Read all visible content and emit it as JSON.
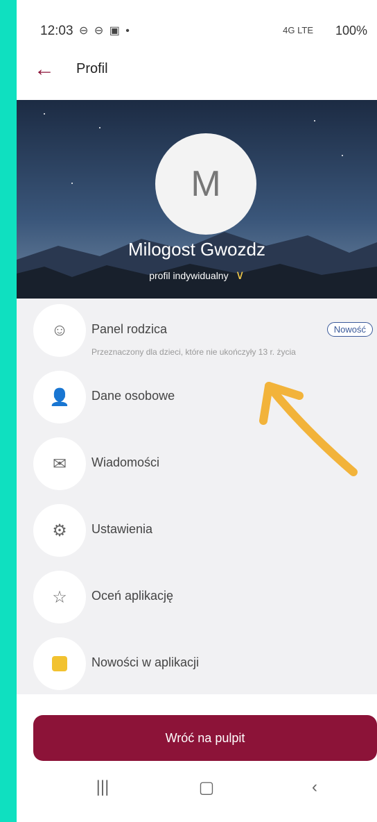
{
  "status_bar": {
    "time": "12:03",
    "left_icons": "⊖ ⊖ ▣ •",
    "network": "4G LTE",
    "battery": "100%"
  },
  "app_bar": {
    "title": "Profil",
    "back_icon": "arrow-left-icon"
  },
  "profile": {
    "avatar_letter": "M",
    "name": "Milogost Gwozdz",
    "type": "profil indywidualny"
  },
  "menu": [
    {
      "label": "Panel rodzica",
      "sub": "Przeznaczony dla dzieci, które nie ukończyły 13 r. życia",
      "badge": "Nowość",
      "icon": "child-face-icon"
    },
    {
      "label": "Dane osobowe",
      "icon": "person-icon"
    },
    {
      "label": "Wiadomości",
      "icon": "envelope-icon"
    },
    {
      "label": "Ustawienia",
      "icon": "gear-icon"
    },
    {
      "label": "Oceń aplikację",
      "icon": "star-icon"
    },
    {
      "label": "Nowości w aplikacji",
      "icon": "news-icon"
    }
  ],
  "actions": {
    "return_button": "Wróć na pulpit"
  },
  "colors": {
    "accent": "#8c1338",
    "frame": "#0fe0c0",
    "annotation_arrow": "#f2b33a"
  }
}
